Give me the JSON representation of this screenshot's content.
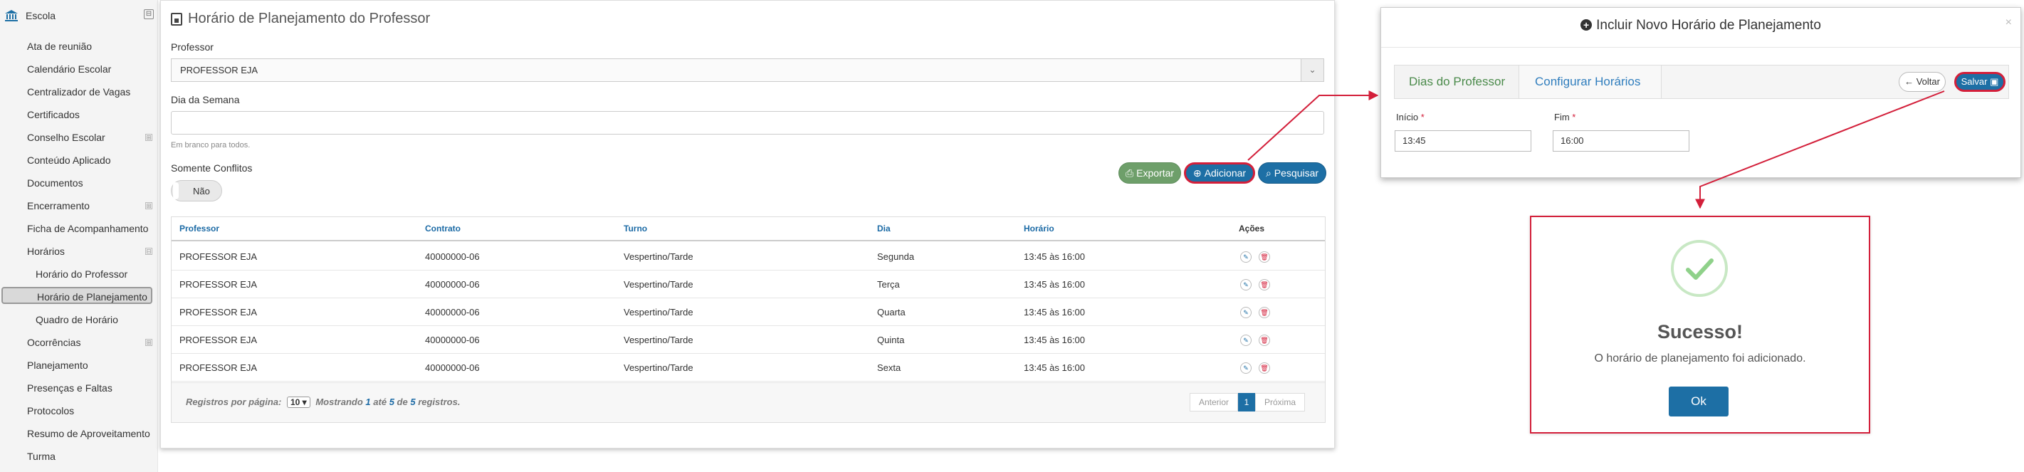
{
  "sidebar": {
    "header": "Escola",
    "collapse_symbol": "⊟",
    "expand_symbol": "⊞",
    "items": [
      {
        "label": "Ata de reunião"
      },
      {
        "label": "Calendário Escolar"
      },
      {
        "label": "Centralizador de Vagas"
      },
      {
        "label": "Certificados"
      },
      {
        "label": "Conselho Escolar"
      },
      {
        "label": "Conteúdo Aplicado"
      },
      {
        "label": "Documentos"
      },
      {
        "label": "Encerramento"
      },
      {
        "label": "Ficha de Acompanhamento"
      },
      {
        "label": "Horários"
      },
      {
        "label": "Horário do Professor"
      },
      {
        "label": "Horário de Planejamento"
      },
      {
        "label": "Quadro de Horário"
      },
      {
        "label": "Ocorrências"
      },
      {
        "label": "Planejamento"
      },
      {
        "label": "Presenças e Faltas"
      },
      {
        "label": "Protocolos"
      },
      {
        "label": "Resumo de Aproveitamento"
      },
      {
        "label": "Turma"
      }
    ]
  },
  "main": {
    "title": "Horário de Planejamento do Professor",
    "professor_label": "Professor",
    "professor_value": "PROFESSOR EJA",
    "day_label": "Dia da Semana",
    "day_hint": "Em branco para todos.",
    "conflicts_label": "Somente Conflitos",
    "conflicts_value": "Não",
    "buttons": {
      "export": "Exportar",
      "add": "Adicionar",
      "search": "Pesquisar"
    },
    "table": {
      "headers": [
        "Professor",
        "Contrato",
        "Turno",
        "Dia",
        "Horário",
        "Ações"
      ],
      "rows": [
        [
          "PROFESSOR EJA",
          "40000000-06",
          "Vespertino/Tarde",
          "Segunda",
          "13:45 às 16:00"
        ],
        [
          "PROFESSOR EJA",
          "40000000-06",
          "Vespertino/Tarde",
          "Terça",
          "13:45 às 16:00"
        ],
        [
          "PROFESSOR EJA",
          "40000000-06",
          "Vespertino/Tarde",
          "Quarta",
          "13:45 às 16:00"
        ],
        [
          "PROFESSOR EJA",
          "40000000-06",
          "Vespertino/Tarde",
          "Quinta",
          "13:45 às 16:00"
        ],
        [
          "PROFESSOR EJA",
          "40000000-06",
          "Vespertino/Tarde",
          "Sexta",
          "13:45 às 16:00"
        ]
      ]
    },
    "footer": {
      "per_page_label": "Registros por página:",
      "per_page_value": "10",
      "showing": "Mostrando",
      "from": "1",
      "until_word": "até",
      "to": "5",
      "of_word": "de",
      "total": "5",
      "records_word": "registros.",
      "prev": "Anterior",
      "page": "1",
      "next": "Próxima"
    }
  },
  "modal": {
    "title": "Incluir Novo Horário de Planejamento",
    "close": "×",
    "step1": "Dias do Professor",
    "step2": "Configurar Horários",
    "back": "Voltar",
    "save": "Salvar",
    "start_label": "Início",
    "start_value": "13:45",
    "end_label": "Fim",
    "end_value": "16:00",
    "required_mark": "*"
  },
  "success": {
    "title": "Sucesso!",
    "message": "O horário de planejamento foi adicionado.",
    "ok": "Ok"
  },
  "colors": {
    "primary": "#1d6fa5",
    "highlight": "#d31f3a",
    "success_green": "#6e9f6a",
    "link_blue": "#1b6aa5"
  }
}
